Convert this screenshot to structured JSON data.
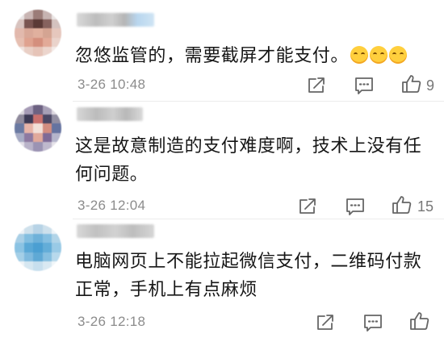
{
  "comments": [
    {
      "text": "忽悠监管的，需要截屏才能支付。",
      "emoji_name": "grimace-emoji",
      "time": "3-26 10:48",
      "likes": "9",
      "icons": [
        "share-icon",
        "comment-icon",
        "like-icon"
      ]
    },
    {
      "text_line1": "这是故意制造的支付难度啊，技术上没有任",
      "text_line2": "何问题。",
      "time": "3-26 12:04",
      "likes": "15",
      "icons": [
        "share-icon",
        "comment-icon",
        "like-icon"
      ]
    },
    {
      "text_line1": "电脑网页上不能拉起微信支付，二维码付款",
      "text_line2": "正常，手机上有点麻烦",
      "time": "3-26 12:18",
      "likes": "",
      "icons": [
        "share-icon",
        "comment-icon",
        "like-icon"
      ]
    }
  ],
  "colors": {
    "text": "#161616",
    "meta": "#8c8c8c",
    "icon": "#666666",
    "divider": "#ececec"
  }
}
